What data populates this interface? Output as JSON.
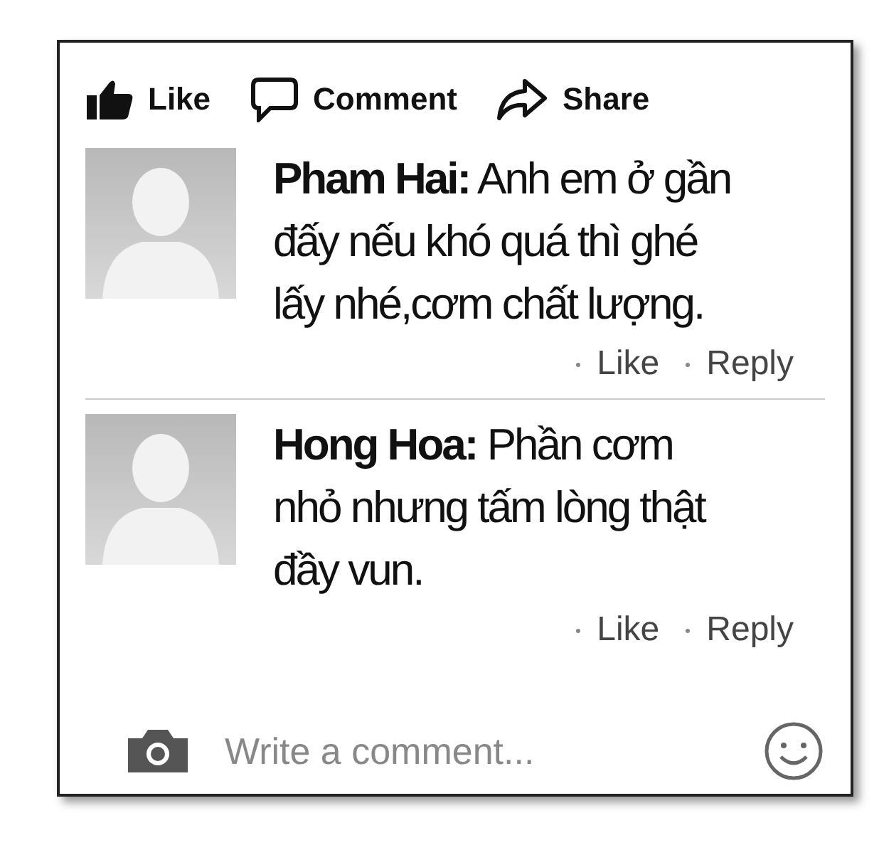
{
  "actions": [
    {
      "kind": "like",
      "label": "Like"
    },
    {
      "kind": "comment",
      "label": "Comment"
    },
    {
      "kind": "share",
      "label": "Share"
    }
  ],
  "comments": [
    {
      "author": "Pham Hai:",
      "text": "Anh em ở gần đấy nếu khó quá thì ghé lấy nhé,cơm chất lượng.",
      "like": "Like",
      "reply": "Reply"
    },
    {
      "author": "Hong Hoa:",
      "text": "Phần cơm nhỏ nhưng tấm lòng thật đầy vun.",
      "like": "Like",
      "reply": "Reply"
    }
  ],
  "composer": {
    "placeholder": "Write a comment..."
  }
}
